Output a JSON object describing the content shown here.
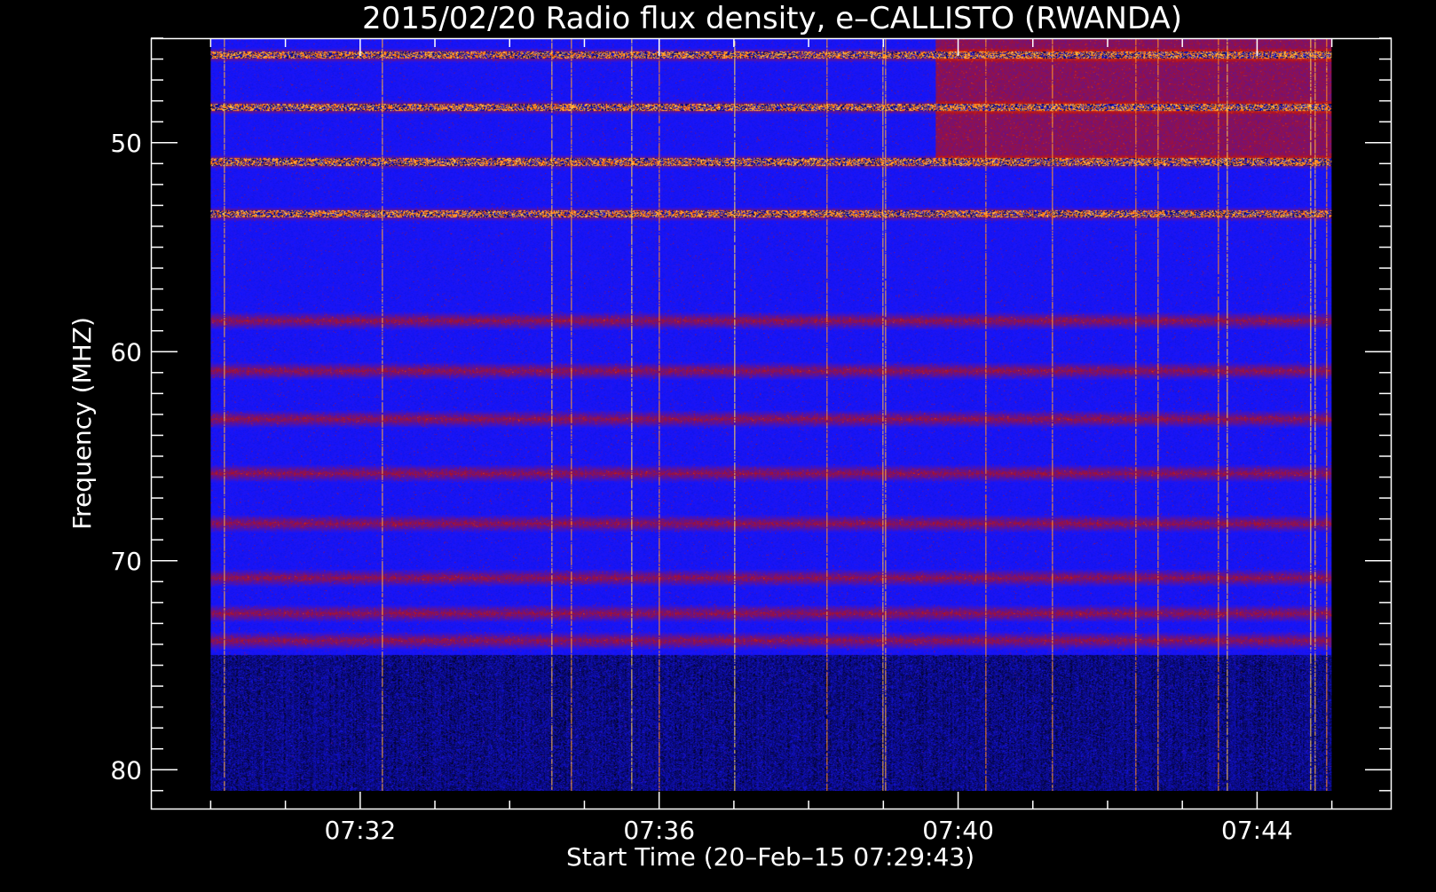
{
  "chart_data": {
    "type": "heatmap",
    "title": "2015/02/20  Radio flux density, e–CALLISTO (RWANDA)",
    "xlabel": "Start Time (20–Feb–15 07:29:43)",
    "ylabel": "Frequency (MHZ)",
    "x_ticks": [
      {
        "value": 2,
        "label": "07:32"
      },
      {
        "value": 6,
        "label": "07:36"
      },
      {
        "value": 10,
        "label": "07:40"
      },
      {
        "value": 14,
        "label": "07:44"
      }
    ],
    "x_minor_step": 1,
    "xlim": [
      -0.8,
      15.8
    ],
    "y_ticks": [
      {
        "value": 50,
        "label": "50"
      },
      {
        "value": 60,
        "label": "60"
      },
      {
        "value": 70,
        "label": "70"
      },
      {
        "value": 80,
        "label": "80"
      }
    ],
    "y_minor_step": 1,
    "ylim": [
      45.0,
      81.9
    ],
    "y_inverted": true,
    "data_range": {
      "x": [
        0,
        15.0
      ],
      "y": [
        45.0,
        81.0
      ]
    },
    "colormap": [
      "#000000",
      "#1515ff",
      "#b01020",
      "#ff5a00",
      "#ffe060"
    ],
    "background": "#000000",
    "frame_color": "#ffffff",
    "hot_bands_mhz": [
      45.8,
      48.3,
      50.9,
      53.4
    ],
    "warm_bands_mhz": [
      58.5,
      60.9,
      63.2,
      65.8,
      68.2,
      70.8,
      72.5,
      73.8
    ],
    "dim_region_below_mhz": 74.5,
    "enhanced_region": {
      "t_start": 9.7,
      "f_min": 45.0,
      "f_max": 51.0
    }
  }
}
